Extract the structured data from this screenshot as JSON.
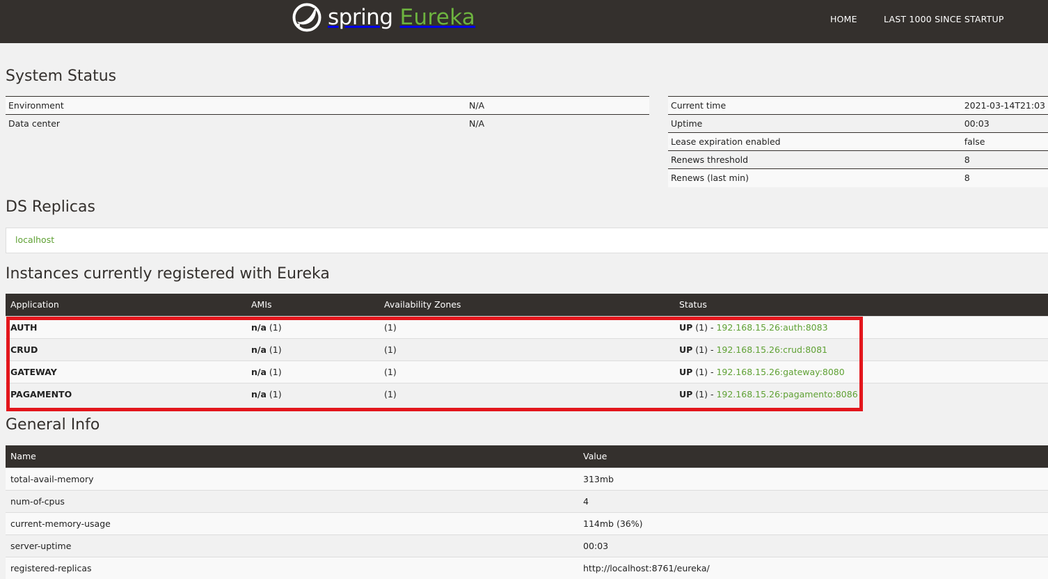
{
  "nav": {
    "brand_spring": "spring",
    "brand_eureka": "Eureka",
    "links": [
      "HOME",
      "LAST 1000 SINCE STARTUP"
    ]
  },
  "system_status": {
    "title": "System Status",
    "left": [
      {
        "label": "Environment",
        "value": "N/A"
      },
      {
        "label": "Data center",
        "value": "N/A"
      }
    ],
    "right": [
      {
        "label": "Current time",
        "value": "2021-03-14T21:03"
      },
      {
        "label": "Uptime",
        "value": "00:03"
      },
      {
        "label": "Lease expiration enabled",
        "value": "false"
      },
      {
        "label": "Renews threshold",
        "value": "8"
      },
      {
        "label": "Renews (last min)",
        "value": "8"
      }
    ]
  },
  "ds_replicas": {
    "title": "DS Replicas",
    "items": [
      "localhost"
    ]
  },
  "instances": {
    "title": "Instances currently registered with Eureka",
    "headers": [
      "Application",
      "AMIs",
      "Availability Zones",
      "Status"
    ],
    "rows": [
      {
        "app": "AUTH",
        "ami_na": "n/a",
        "ami_count": " (1)",
        "zones": "(1)",
        "status_up": "UP",
        "status_count": " (1) - ",
        "link": "192.168.15.26:auth:8083"
      },
      {
        "app": "CRUD",
        "ami_na": "n/a",
        "ami_count": " (1)",
        "zones": "(1)",
        "status_up": "UP",
        "status_count": " (1) - ",
        "link": "192.168.15.26:crud:8081"
      },
      {
        "app": "GATEWAY",
        "ami_na": "n/a",
        "ami_count": " (1)",
        "zones": "(1)",
        "status_up": "UP",
        "status_count": " (1) - ",
        "link": "192.168.15.26:gateway:8080"
      },
      {
        "app": "PAGAMENTO",
        "ami_na": "n/a",
        "ami_count": " (1)",
        "zones": "(1)",
        "status_up": "UP",
        "status_count": " (1) - ",
        "link": "192.168.15.26:pagamento:8086"
      }
    ]
  },
  "general_info": {
    "title": "General Info",
    "headers": [
      "Name",
      "Value"
    ],
    "rows": [
      {
        "name": "total-avail-memory",
        "value": "313mb"
      },
      {
        "name": "num-of-cpus",
        "value": "4"
      },
      {
        "name": "current-memory-usage",
        "value": "114mb (36%)"
      },
      {
        "name": "server-uptime",
        "value": "00:03"
      },
      {
        "name": "registered-replicas",
        "value": "http://localhost:8761/eureka/"
      }
    ]
  },
  "colors": {
    "nav_bg": "#34302d",
    "brand_green": "#6db33f",
    "link_green": "#5fa134",
    "highlight_red": "#e3161c"
  }
}
